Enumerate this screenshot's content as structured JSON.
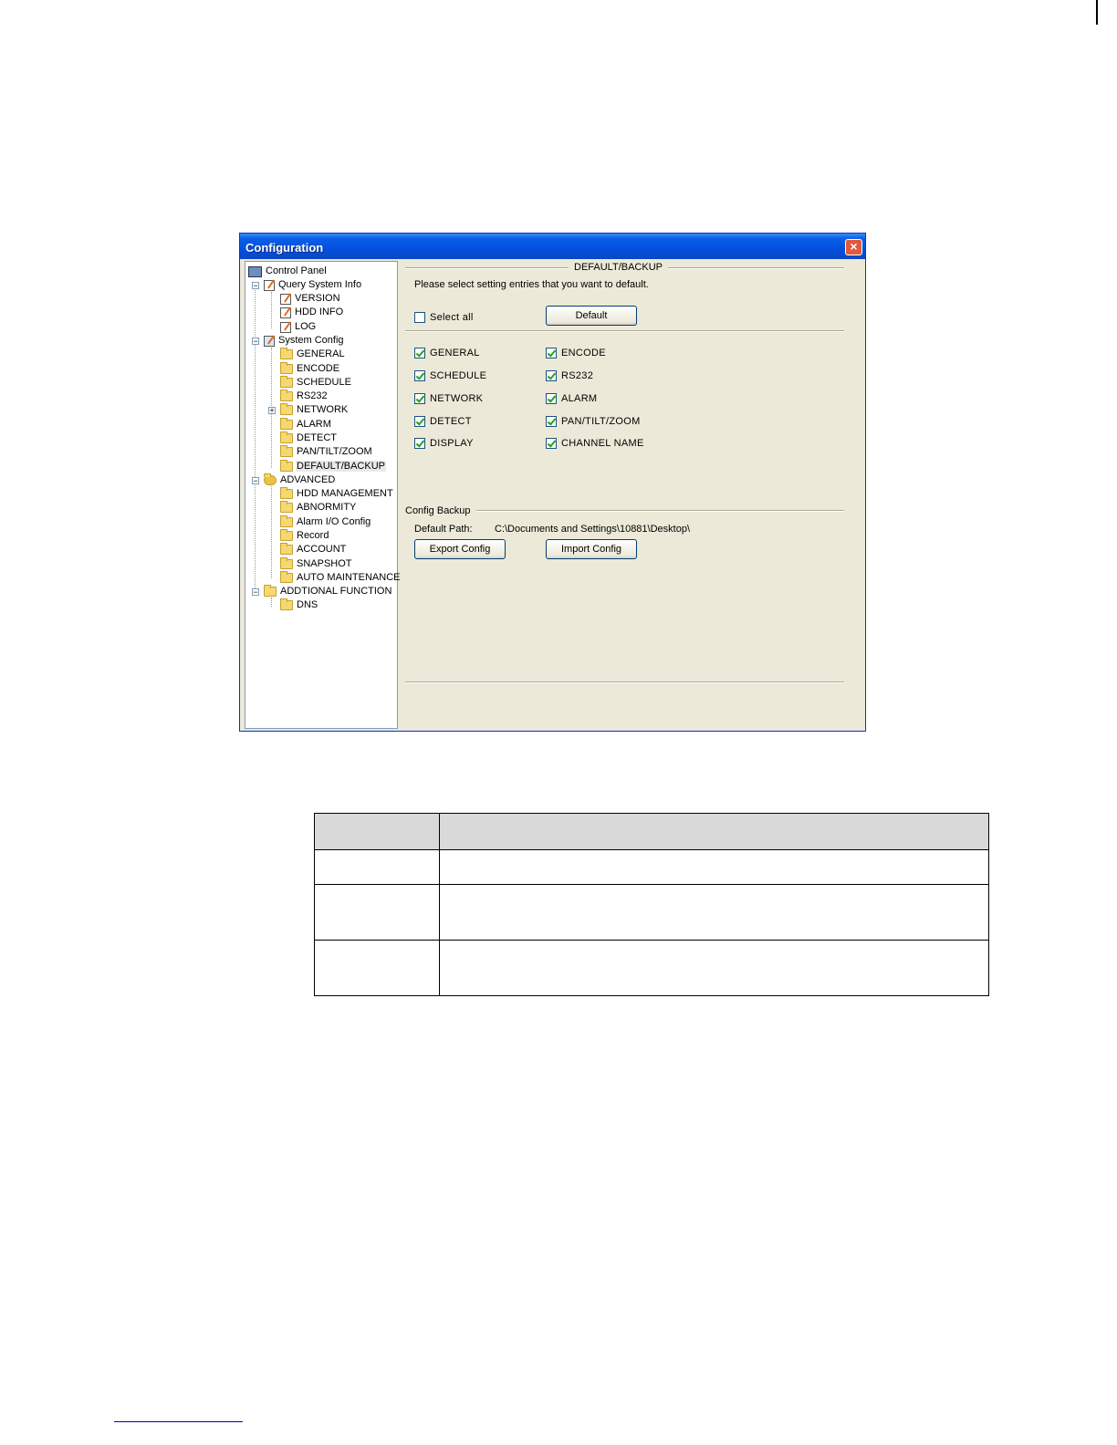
{
  "window": {
    "title": "Configuration",
    "close_label": "×"
  },
  "tree": {
    "root": "Control Panel",
    "query_system_info": {
      "label": "Query System Info",
      "items": [
        "VERSION",
        "HDD INFO",
        "LOG"
      ]
    },
    "system_config": {
      "label": "System Config",
      "items": [
        "GENERAL",
        "ENCODE",
        "SCHEDULE",
        "RS232",
        "NETWORK",
        "ALARM",
        "DETECT",
        "PAN/TILT/ZOOM",
        "DEFAULT/BACKUP"
      ],
      "selected": "DEFAULT/BACKUP"
    },
    "advanced": {
      "label": "ADVANCED",
      "items": [
        "HDD MANAGEMENT",
        "ABNORMITY",
        "Alarm I/O Config",
        "Record",
        "ACCOUNT",
        "SNAPSHOT",
        "AUTO MAINTENANCE"
      ]
    },
    "additional": {
      "label": "ADDTIONAL FUNCTION",
      "items": [
        "DNS"
      ]
    }
  },
  "panel": {
    "group_title": "DEFAULT/BACKUP",
    "instruction": "Please select setting entries that you want to default.",
    "select_all_label": "Select all",
    "select_all_checked": false,
    "default_button": "Default",
    "entries": [
      {
        "label": "GENERAL",
        "checked": true
      },
      {
        "label": "ENCODE",
        "checked": true
      },
      {
        "label": "SCHEDULE",
        "checked": true
      },
      {
        "label": "RS232",
        "checked": true
      },
      {
        "label": "NETWORK",
        "checked": true
      },
      {
        "label": "ALARM",
        "checked": true
      },
      {
        "label": "DETECT",
        "checked": true
      },
      {
        "label": "PAN/TILT/ZOOM",
        "checked": true
      },
      {
        "label": "DISPLAY",
        "checked": true
      },
      {
        "label": "CHANNEL NAME",
        "checked": true
      }
    ],
    "backup": {
      "title": "Config Backup",
      "path_label": "Default Path:",
      "path_value": "C:\\Documents and Settings\\10881\\Desktop\\",
      "export_button": "Export Config",
      "import_button": "Import Config"
    }
  },
  "table": {
    "header": [
      "",
      ""
    ],
    "rows": [
      [
        "",
        ""
      ],
      [
        "",
        ""
      ],
      [
        "",
        ""
      ]
    ]
  }
}
